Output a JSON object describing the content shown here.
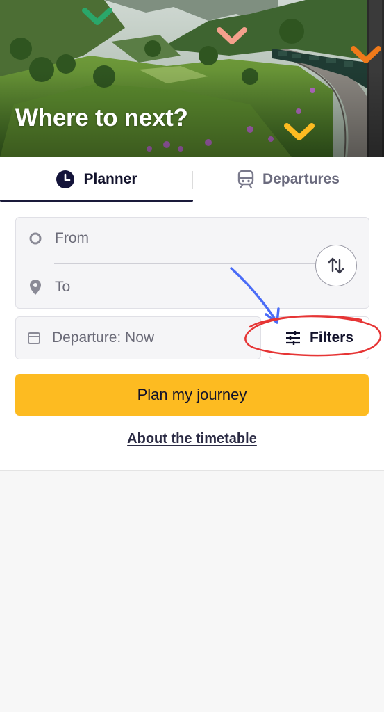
{
  "hero": {
    "title": "Where to next?"
  },
  "tabs": [
    {
      "label": "Planner",
      "icon": "clock-icon",
      "active": true
    },
    {
      "label": "Departures",
      "icon": "train-icon",
      "active": false
    }
  ],
  "route": {
    "from_placeholder": "From",
    "to_placeholder": "To"
  },
  "departure": {
    "label": "Departure: Now"
  },
  "filters": {
    "label": "Filters"
  },
  "actions": {
    "plan_label": "Plan my journey",
    "about_label": "About the timetable"
  },
  "colors": {
    "primary_button": "#fdbb21",
    "annotation_arrow": "#4a6cf7",
    "annotation_circle": "#e63535",
    "chevron_green": "#2aa76a",
    "chevron_pink": "#f4a08c",
    "chevron_orange": "#f07a1a",
    "chevron_yellow": "#fdbb21"
  }
}
